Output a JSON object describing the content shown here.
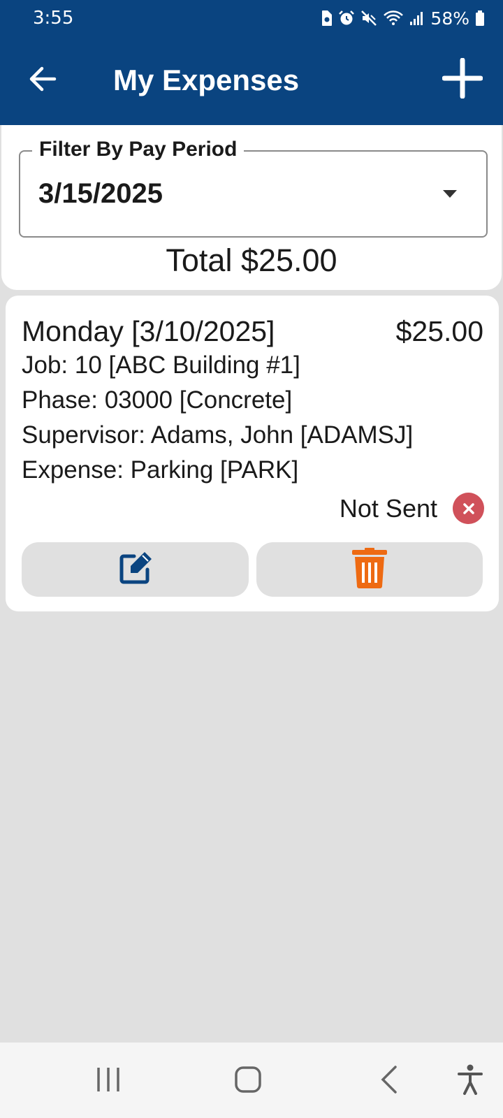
{
  "status_bar": {
    "time": "3:55",
    "battery": "58%",
    "icons": [
      "sim-icon",
      "alarm-icon",
      "mute-icon",
      "wifi-icon",
      "signal-icon",
      "battery-icon"
    ]
  },
  "app_bar": {
    "title": "My Expenses",
    "back_icon": "arrow-left-icon",
    "add_icon": "plus-icon"
  },
  "filter": {
    "label": "Filter By Pay Period",
    "value": "3/15/2025",
    "total": "Total $25.00"
  },
  "expenses": [
    {
      "date": "Monday [3/10/2025]",
      "amount": "$25.00",
      "job": "Job: 10 [ABC Building #1]",
      "phase": "Phase: 03000 [Concrete]",
      "supervisor": "Supervisor: Adams, John [ADAMSJ]",
      "expense": "Expense: Parking [PARK]",
      "status": "Not Sent",
      "status_icon": "x-circle-icon",
      "edit_icon": "edit-icon",
      "delete_icon": "trash-icon"
    }
  ],
  "colors": {
    "primary": "#0a4480",
    "background": "#e0e0e0",
    "delete": "#ee6a12",
    "error": "#d0515a",
    "edit": "#0a4480"
  },
  "nav": [
    "recents-icon",
    "home-icon",
    "back-icon",
    "accessibility-icon"
  ]
}
